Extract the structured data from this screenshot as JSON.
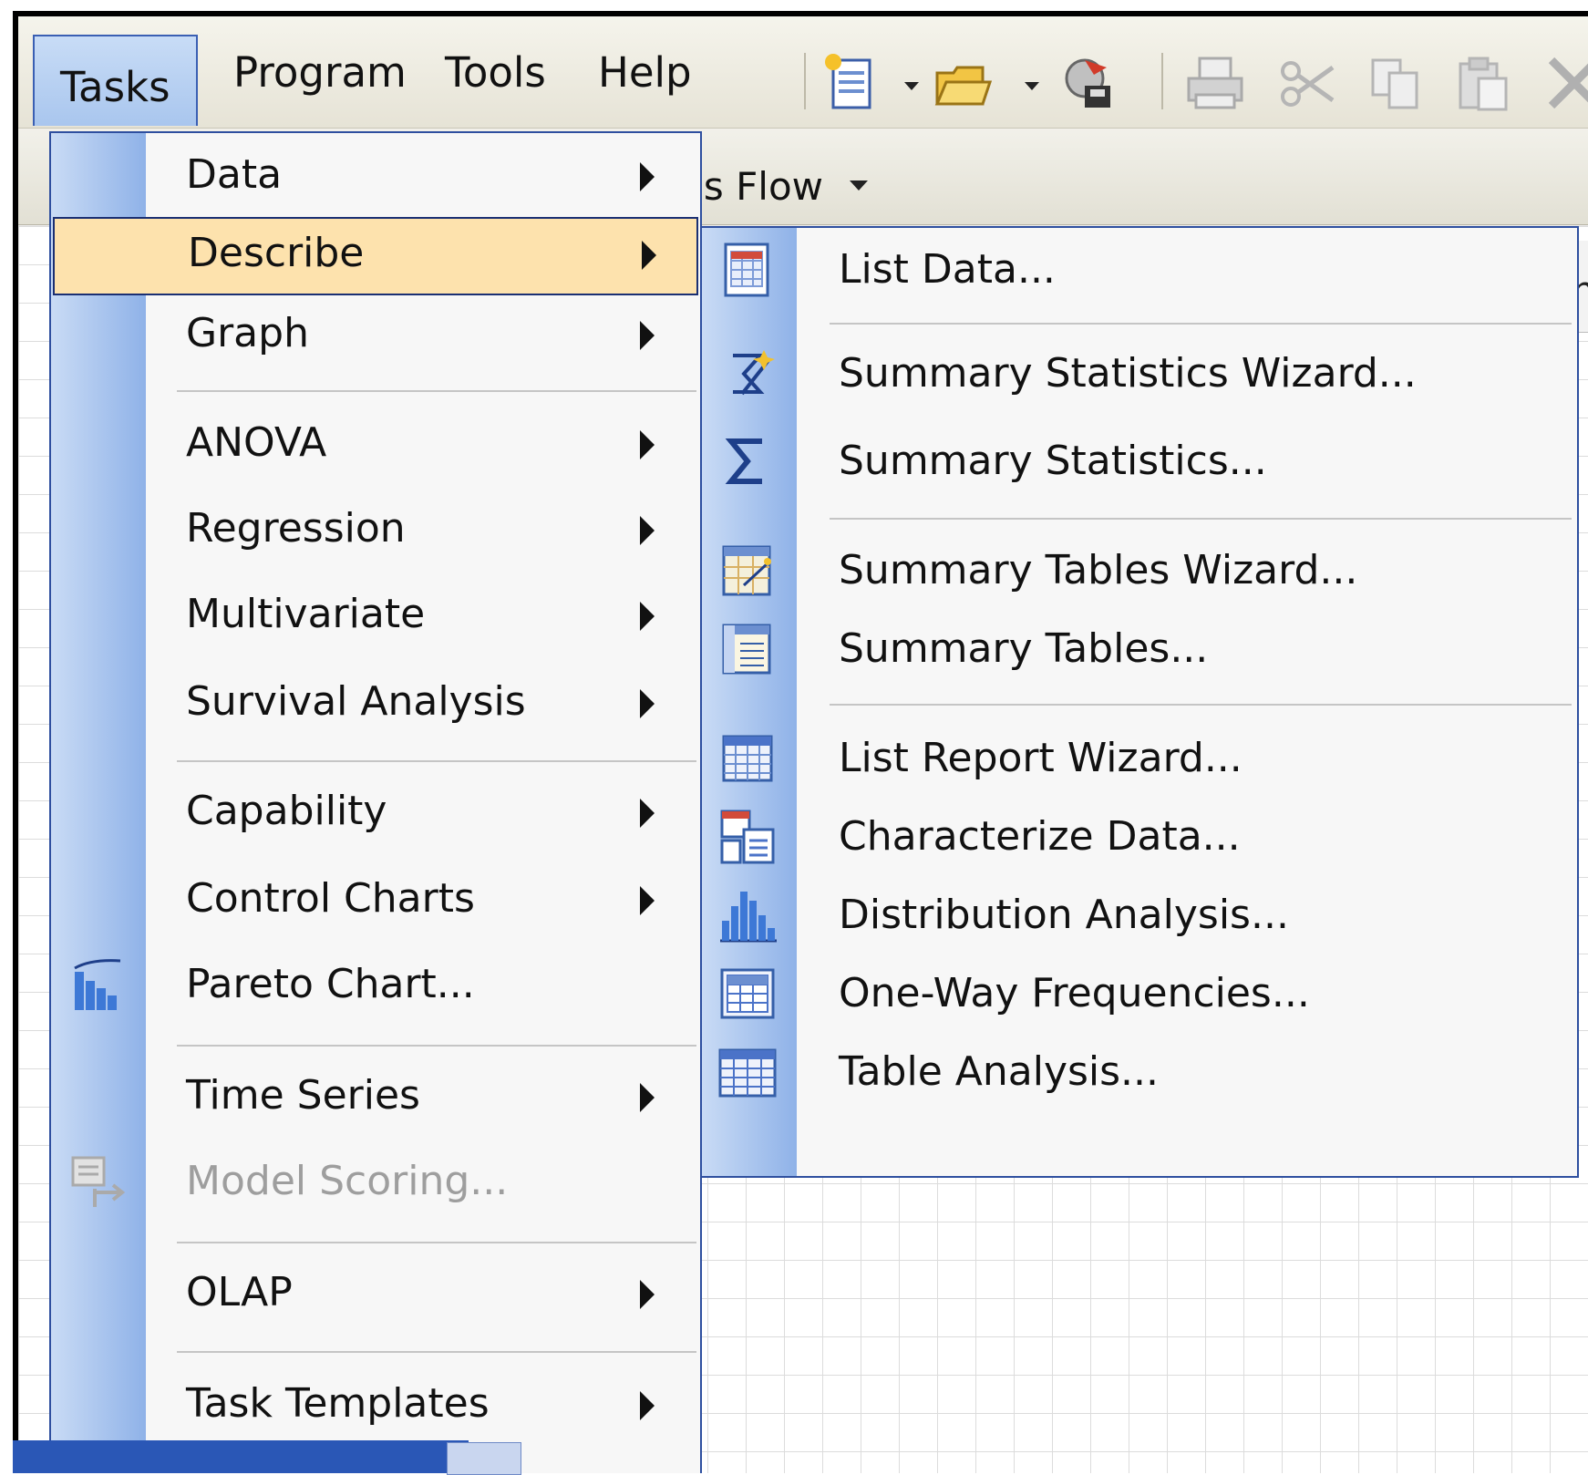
{
  "menubar": {
    "menus": [
      {
        "label": "Tasks",
        "active": true
      },
      {
        "label": "Program",
        "active": false
      },
      {
        "label": "Tools",
        "active": false
      },
      {
        "label": "Help",
        "active": false
      }
    ],
    "toolbar_icons": [
      "new-document-icon",
      "open-folder-icon",
      "stop-run-icon",
      "print-icon",
      "cut-icon",
      "copy-icon",
      "paste-icon",
      "delete-icon"
    ]
  },
  "background": {
    "flow_label": "ss Flow",
    "column_header_fragment": "m"
  },
  "tasks_menu": {
    "items": [
      {
        "label": "Data",
        "submenu": true
      },
      {
        "label": "Describe",
        "submenu": true,
        "highlighted": true
      },
      {
        "label": "Graph",
        "submenu": true
      },
      {
        "label": "ANOVA",
        "submenu": true
      },
      {
        "label": "Regression",
        "submenu": true
      },
      {
        "label": "Multivariate",
        "submenu": true
      },
      {
        "label": "Survival Analysis",
        "submenu": true
      },
      {
        "label": "Capability",
        "submenu": true
      },
      {
        "label": "Control Charts",
        "submenu": true
      },
      {
        "label": "Pareto Chart...",
        "submenu": false,
        "icon": "pareto-chart-icon"
      },
      {
        "label": "Time Series",
        "submenu": true
      },
      {
        "label": "Model Scoring...",
        "submenu": false,
        "disabled": true,
        "icon": "model-scoring-icon"
      },
      {
        "label": "OLAP",
        "submenu": true
      },
      {
        "label": "Task Templates",
        "submenu": true
      }
    ]
  },
  "describe_submenu": {
    "items": [
      {
        "label": "List Data...",
        "icon": "list-data-icon"
      },
      {
        "label": "Summary Statistics Wizard...",
        "icon": "wizard-icon"
      },
      {
        "label": "Summary Statistics...",
        "icon": "sigma-icon"
      },
      {
        "label": "Summary Tables Wizard...",
        "icon": "summary-tables-wizard-icon"
      },
      {
        "label": "Summary Tables...",
        "icon": "summary-tables-icon"
      },
      {
        "label": "List Report Wizard...",
        "icon": "list-report-wizard-icon"
      },
      {
        "label": "Characterize Data...",
        "icon": "characterize-data-icon"
      },
      {
        "label": "Distribution Analysis...",
        "icon": "distribution-analysis-icon"
      },
      {
        "label": "One-Way Frequencies...",
        "icon": "one-way-frequencies-icon"
      },
      {
        "label": "Table Analysis...",
        "icon": "table-analysis-icon"
      }
    ]
  },
  "colors": {
    "highlight": "#fde2ad",
    "menu_border": "#2e4f9f",
    "rail": "#8fb2e8",
    "disabled_text": "#9e9e9e"
  }
}
